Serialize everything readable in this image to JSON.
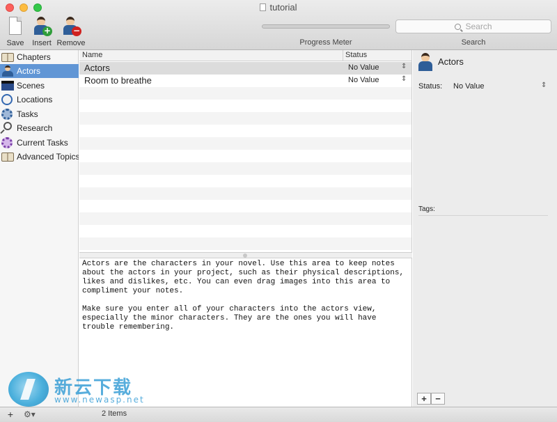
{
  "window": {
    "title": "tutorial"
  },
  "toolbar": {
    "save_label": "Save",
    "insert_label": "Insert",
    "remove_label": "Remove",
    "progress_label": "Progress Meter",
    "search_placeholder": "Search",
    "search_label": "Search",
    "progress_value": 0
  },
  "sidebar": {
    "items": [
      {
        "label": "Chapters",
        "icon": "book-icon",
        "selected": false
      },
      {
        "label": "Actors",
        "icon": "person-icon",
        "selected": true
      },
      {
        "label": "Scenes",
        "icon": "clapperboard-icon",
        "selected": false
      },
      {
        "label": "Locations",
        "icon": "compass-icon",
        "selected": false
      },
      {
        "label": "Tasks",
        "icon": "gear-icon",
        "selected": false
      },
      {
        "label": "Research",
        "icon": "magnifier-icon",
        "selected": false
      },
      {
        "label": "Current Tasks",
        "icon": "gear-icon",
        "selected": false
      },
      {
        "label": "Advanced Topics",
        "icon": "book-icon",
        "selected": false
      }
    ]
  },
  "table": {
    "columns": [
      "Name",
      "Status"
    ],
    "rows": [
      {
        "name": "Actors",
        "status": "No Value"
      },
      {
        "name": "Room to breathe",
        "status": "No Value"
      }
    ]
  },
  "notes": {
    "text": "Actors are the characters in your novel. Use this area to keep notes\nabout the actors in your project, such as their physical descriptions,\nlikes and dislikes, etc. You can even drag images into this area to\ncompliment your notes.\n\nMake sure you enter all of your characters into the actors view,\nespecially the minor characters. They are the ones you will have\ntrouble remembering."
  },
  "inspector": {
    "title": "Actors",
    "status_label": "Status:",
    "status_value": "No Value",
    "tags_label": "Tags:",
    "add_label": "+",
    "remove_label": "−"
  },
  "bottom": {
    "add_label": "+",
    "gear_label": "⚙▾",
    "count": "2 Items"
  },
  "watermark": {
    "cn": "新云下载",
    "url": "www.newasp.net"
  },
  "colors": {
    "selection": "#6196d5",
    "accent_blue": "#2f5e98"
  }
}
